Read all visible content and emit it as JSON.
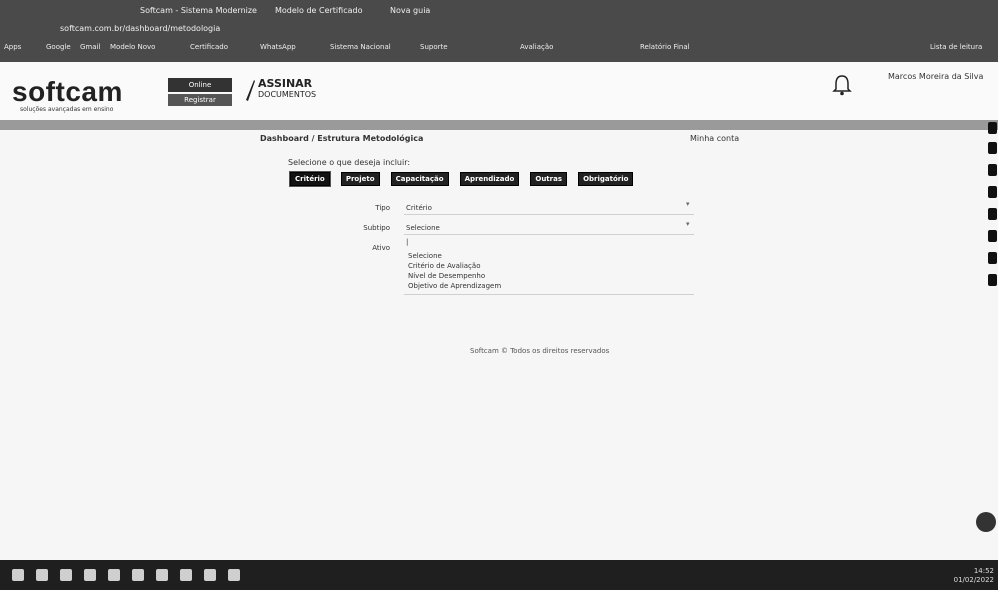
{
  "browser": {
    "tabs": [
      "Softcam - Sistema Modernize",
      "Modelo de Certificado",
      "Nova guia"
    ],
    "url": "softcam.com.br/dashboard/metodologia",
    "bookmarks": [
      "Apps",
      "Google",
      "Gmail",
      "Modelo Novo",
      "Certificado",
      "WhatsApp",
      "Sistema Nacional",
      "Suporte",
      "Avaliação",
      "Relatório Final",
      "Lista de leitura"
    ]
  },
  "header": {
    "logo": "softcam",
    "logo_tagline": "soluções avançadas em ensino",
    "badge_top": "Online",
    "badge_bottom": "Registrar",
    "sign_line1": "ASSINAR",
    "sign_line2": "DOCUMENTOS",
    "user_name": "Marcos Moreira da Silva"
  },
  "content": {
    "breadcrumb": "Dashboard / Estrutura Metodológica",
    "right_link": "Minha conta",
    "question": "Selecione o que deseja incluir:",
    "buttons": [
      "Critério",
      "Projeto",
      "Capacitação",
      "Aprendizado",
      "Outras",
      "Obrigatório"
    ],
    "fields": {
      "tipo_label": "Tipo",
      "tipo_value": "Critério",
      "subtipo_label": "Subtipo",
      "subtipo_value": "Selecione",
      "ativo_label": "Ativo",
      "options": [
        "Selecione",
        "Critério de Avaliação",
        "Nível de Desempenho",
        "Objetivo de Aprendizagem"
      ]
    },
    "footer": "Softcam © Todos os direitos reservados"
  },
  "taskbar": {
    "clock_time": "14:52",
    "clock_date": "01/02/2022"
  }
}
